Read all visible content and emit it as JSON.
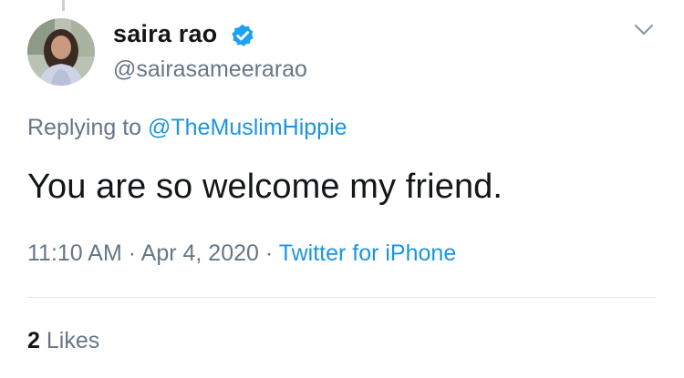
{
  "tweet": {
    "display_name": "saira rao",
    "handle": "@sairasameerarao",
    "reply_prefix": "Replying to",
    "reply_to": "@TheMuslimHippie",
    "text": "You are so welcome my friend.",
    "time": "11:10 AM",
    "separator": "·",
    "date": "Apr 4, 2020",
    "source": "Twitter for iPhone",
    "likes_count": "2",
    "likes_label": "Likes"
  },
  "icons": {
    "verified": "verified-badge-icon",
    "menu": "chevron-down-icon"
  },
  "colors": {
    "link": "#1b95e0",
    "secondary_text": "#657786",
    "primary_text": "#14171a",
    "verified_badge": "#1da1f2"
  }
}
